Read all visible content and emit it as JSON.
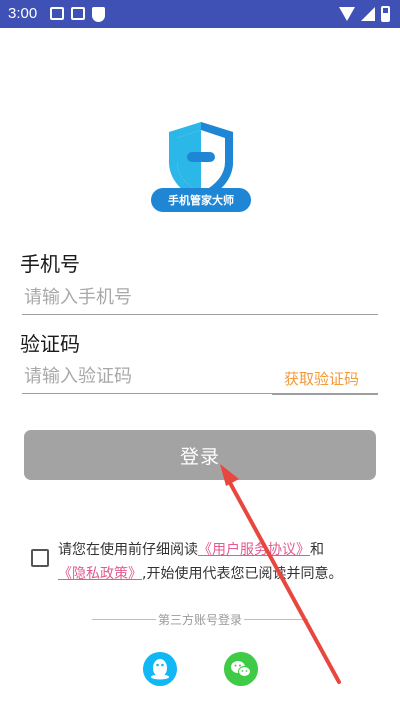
{
  "status_bar": {
    "time": "3:00"
  },
  "brand": {
    "logo_text": "手机管家大师"
  },
  "form": {
    "phone_label": "手机号",
    "phone_placeholder": "请输入手机号",
    "code_label": "验证码",
    "code_placeholder": "请输入验证码",
    "get_code": "获取验证码"
  },
  "login_button": "登录",
  "agreement": {
    "prefix": "请您在使用前仔细阅读",
    "user_agreement": "《用户服务协议》",
    "and": "和",
    "privacy_policy": "《隐私政策》",
    "suffix": ",开始使用代表您已阅读并同意。"
  },
  "third_party": {
    "label": "第三方账号登录"
  },
  "colors": {
    "status_bar": "#3f51b5",
    "accent_orange": "#f39a3a",
    "link_pink": "#e35b8f",
    "login_disabled": "#a3a3a3",
    "annotation_red": "#e8473f"
  },
  "icons": [
    "image-icon",
    "text-icon",
    "shield-icon",
    "wifi-icon",
    "signal-icon",
    "battery-icon",
    "qq-icon",
    "wechat-icon"
  ]
}
